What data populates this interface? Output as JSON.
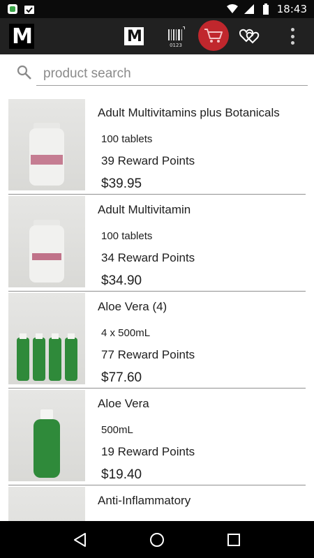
{
  "status_bar": {
    "time": "18:43",
    "icons": [
      "notification-app-icon",
      "notification-check-icon",
      "wifi-icon",
      "signal-icon",
      "battery-icon"
    ]
  },
  "app_bar": {
    "logo_letter": "M",
    "brand_button_letter": "M",
    "barcode_caption": "0123",
    "icons": [
      "barcode-scan-icon",
      "cart-icon",
      "wishlist-hearts-icon",
      "overflow-menu-icon"
    ],
    "cart_color": "#c0272d"
  },
  "search": {
    "placeholder": "product search",
    "value": ""
  },
  "products": [
    {
      "name": "Adult Multivitamins plus Botanicals",
      "size": "100 tablets",
      "points": "39 Reward Points",
      "price": "$39.95"
    },
    {
      "name": "Adult Multivitamin",
      "size": "100 tablets",
      "points": "34 Reward Points",
      "price": "$34.90"
    },
    {
      "name": "Aloe Vera (4)",
      "size": "4 x 500mL",
      "points": "77 Reward Points",
      "price": "$77.60"
    },
    {
      "name": "Aloe Vera",
      "size": "500mL",
      "points": "19 Reward Points",
      "price": "$19.40"
    },
    {
      "name": "Anti-Inflammatory",
      "size": "",
      "points": "",
      "price": ""
    }
  ],
  "nav_bar": {
    "icons": [
      "back-icon",
      "home-icon",
      "recents-icon"
    ]
  }
}
